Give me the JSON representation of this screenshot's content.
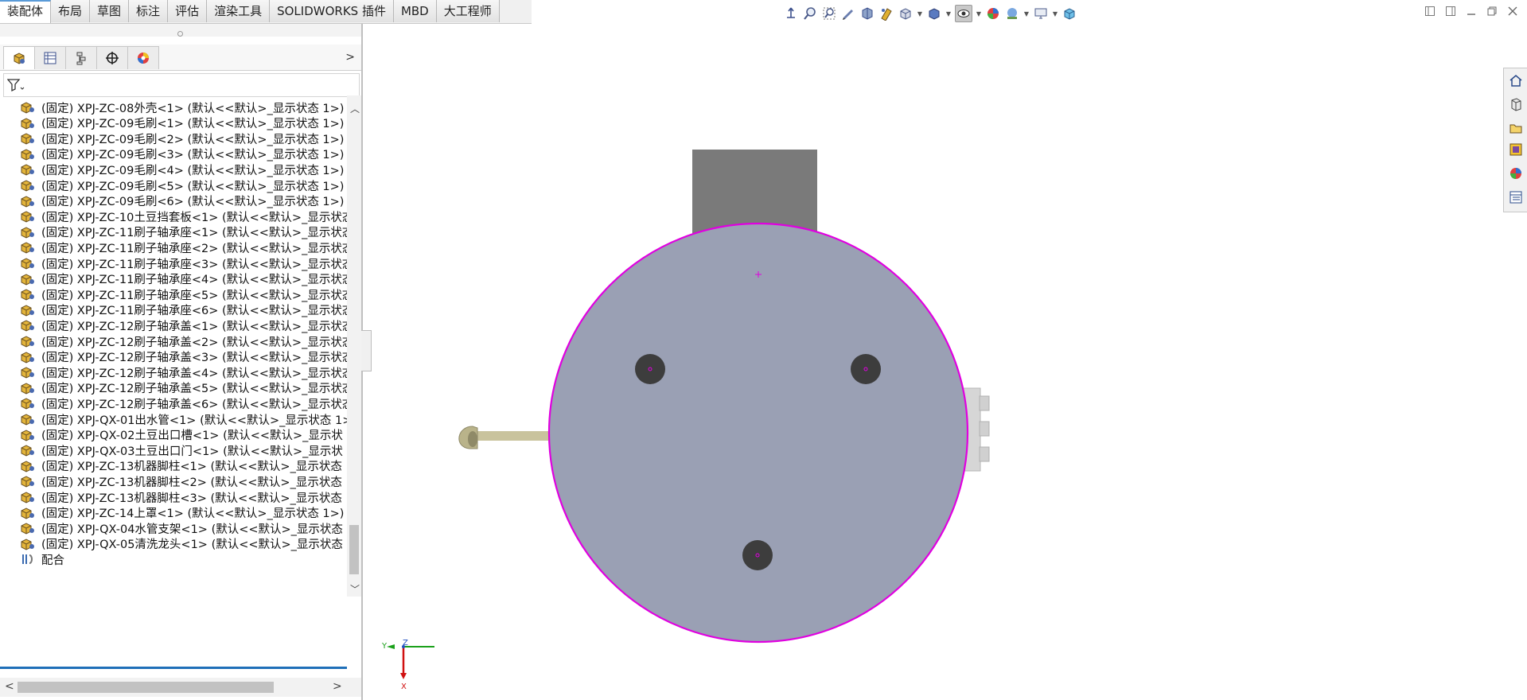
{
  "command_tabs": [
    "装配体",
    "布局",
    "草图",
    "标注",
    "评估",
    "渲染工具",
    "SOLIDWORKS 插件",
    "MBD",
    "大工程师"
  ],
  "hud_icons": [
    "view-orientation-icon",
    "zoom-to-fit-icon",
    "zoom-to-area-icon",
    "previous-view-icon",
    "section-view-icon",
    "dynamic-annotation-icon",
    "view-3d-icon",
    "display-style-icon",
    "hide-show-icon",
    "edit-appearance-icon",
    "apply-scene-icon",
    "view-settings-icon",
    "cube-icon"
  ],
  "window_controls": [
    "restore-pane-left-icon",
    "restore-pane-right-icon",
    "minimize-icon",
    "restore-icon",
    "close-icon"
  ],
  "tree": {
    "rows": [
      "(固定) XPJ-ZC-08外壳<1> (默认<<默认>_显示状态 1>)",
      "(固定) XPJ-ZC-09毛刷<1> (默认<<默认>_显示状态 1>)",
      "(固定) XPJ-ZC-09毛刷<2> (默认<<默认>_显示状态 1>)",
      "(固定) XPJ-ZC-09毛刷<3> (默认<<默认>_显示状态 1>)",
      "(固定) XPJ-ZC-09毛刷<4> (默认<<默认>_显示状态 1>)",
      "(固定) XPJ-ZC-09毛刷<5> (默认<<默认>_显示状态 1>)",
      "(固定) XPJ-ZC-09毛刷<6> (默认<<默认>_显示状态 1>)",
      "(固定) XPJ-ZC-10土豆挡套板<1> (默认<<默认>_显示状态",
      "(固定) XPJ-ZC-11刷子轴承座<1> (默认<<默认>_显示状态",
      "(固定) XPJ-ZC-11刷子轴承座<2> (默认<<默认>_显示状态",
      "(固定) XPJ-ZC-11刷子轴承座<3> (默认<<默认>_显示状态",
      "(固定) XPJ-ZC-11刷子轴承座<4> (默认<<默认>_显示状态",
      "(固定) XPJ-ZC-11刷子轴承座<5> (默认<<默认>_显示状态",
      "(固定) XPJ-ZC-11刷子轴承座<6> (默认<<默认>_显示状态",
      "(固定) XPJ-ZC-12刷子轴承盖<1> (默认<<默认>_显示状态",
      "(固定) XPJ-ZC-12刷子轴承盖<2> (默认<<默认>_显示状态",
      "(固定) XPJ-ZC-12刷子轴承盖<3> (默认<<默认>_显示状态",
      "(固定) XPJ-ZC-12刷子轴承盖<4> (默认<<默认>_显示状态",
      "(固定) XPJ-ZC-12刷子轴承盖<5> (默认<<默认>_显示状态",
      "(固定) XPJ-ZC-12刷子轴承盖<6> (默认<<默认>_显示状态",
      "(固定) XPJ-QX-01出水管<1> (默认<<默认>_显示状态 1>",
      "(固定) XPJ-QX-02土豆出口槽<1> (默认<<默认>_显示状",
      "(固定) XPJ-QX-03土豆出口门<1> (默认<<默认>_显示状",
      "(固定) XPJ-ZC-13机器脚柱<1> (默认<<默认>_显示状态",
      "(固定) XPJ-ZC-13机器脚柱<2> (默认<<默认>_显示状态",
      "(固定) XPJ-ZC-13机器脚柱<3> (默认<<默认>_显示状态",
      "(固定) XPJ-ZC-14上罩<1> (默认<<默认>_显示状态 1>)",
      "(固定) XPJ-QX-04水管支架<1> (默认<<默认>_显示状态",
      "(固定) XPJ-QX-05清洗龙头<1> (默认<<默认>_显示状态"
    ],
    "mates_label": "配合"
  },
  "triad": {
    "y_label": "Y",
    "z_label": "Z",
    "x_label": "X"
  },
  "colors": {
    "accent": "#1f6fb8",
    "disk": "#9aa0b4",
    "disk_edge": "#e000e0",
    "block": "#7a7a7a",
    "hole": "#3d3d3d",
    "pipe": "#cbc5a0",
    "connector": "#d4d4d4"
  }
}
